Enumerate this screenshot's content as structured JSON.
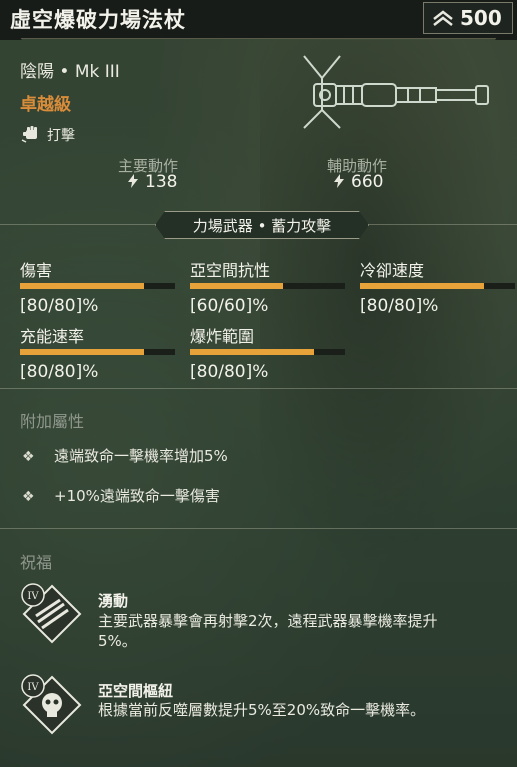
{
  "header": {
    "title": "虛空爆破力場法杖",
    "price": "500",
    "price_icon": "chevron-up-stack-icon"
  },
  "item": {
    "family": "陰陽 • Mk III",
    "rarity": "卓越級",
    "rarity_color": "#d98c3a",
    "attack_type": "打擊",
    "attack_icon": "fist-icon"
  },
  "actions": {
    "primary_label": "主要動作",
    "primary_value": "138",
    "secondary_label": "輔助動作",
    "secondary_value": "660"
  },
  "weapon_class": "力場武器 • 蓄力攻擊",
  "stats": [
    {
      "label": "傷害",
      "value": "[80/80]%",
      "fill": 0.8
    },
    {
      "label": "亞空間抗性",
      "value": "[60/60]%",
      "fill": 0.6
    },
    {
      "label": "冷卻速度",
      "value": "[80/80]%",
      "fill": 0.8
    },
    {
      "label": "充能速率",
      "value": "[80/80]%",
      "fill": 0.8
    },
    {
      "label": "爆炸範圍",
      "value": "[80/80]%",
      "fill": 0.8
    }
  ],
  "perks": {
    "title": "附加屬性",
    "items": [
      "遠端致命一擊機率增加5%",
      "+10%遠端致命一擊傷害"
    ]
  },
  "blessings": {
    "title": "祝福",
    "items": [
      {
        "tier": "IV",
        "name": "湧動",
        "desc": "主要武器暴擊會再射擊2次，遠程武器暴擊機率提升5%。"
      },
      {
        "tier": "IV",
        "name": "亞空間樞紐",
        "desc": "根據當前反噬層數提升5%至20%致命一擊機率。"
      }
    ]
  },
  "accent_color": "#e8a23a"
}
